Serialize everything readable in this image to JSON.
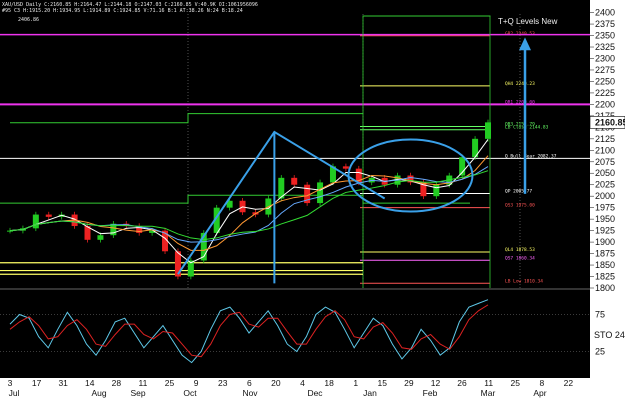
{
  "header": {
    "line1": "XAU/USD Daily  C:2160.85  H:2164.47  L:2144.18  O:2147.03  C:2160.85  V:40.9K  OI:1061956096",
    "line2": "#95 C3  H:1915.20  H:1934.95  L:1914.89  C:1924.85  V:71.16  B:1  AT:38.26  N:24  B:18.24",
    "top_value": "2406.86",
    "study_label": "T+Q Levels New"
  },
  "colors": {
    "background": "#000000",
    "axis_panel": "#ffffff",
    "bull_candle": "#22cc22",
    "bear_candle": "#ee2222",
    "magenta_level": "#ee33ee",
    "yellow_level": "#ffff66",
    "blue_annotation": "#3aa0e8",
    "stoch_k": "#5ec8e8",
    "stoch_d": "#dd2222"
  },
  "last_price_tag": "2160.85",
  "levels": [
    {
      "price": 2349.53,
      "label": "GR2 2349.53",
      "color": "#ff5555"
    },
    {
      "price": 2240.23,
      "label": "QH4 2240.23",
      "color": "#ffff66"
    },
    {
      "price": 2200.0,
      "label": "QR1 2200.00",
      "color": "#ee33ee"
    },
    {
      "price": 2151.79,
      "label": "QR3 2151.79",
      "color": "#66ff66"
    },
    {
      "price": 2144.83,
      "label": "LB Close 2144.83",
      "color": "#66ff66"
    },
    {
      "price": 2082.37,
      "label": "Q Bull Bear 2082.37",
      "color": "#ffffff"
    },
    {
      "price": 2005.77,
      "label": "QP 2005.77",
      "color": "#ffffff"
    },
    {
      "price": 1975.0,
      "label": "QS3 1975.00",
      "color": "#ff5555"
    },
    {
      "price": 1878.53,
      "label": "QL4 1878.53",
      "color": "#ffff66"
    },
    {
      "price": 1860.34,
      "label": "QS7 1860.34",
      "color": "#ff66ff"
    },
    {
      "price": 1810.34,
      "label": "LB Low 1810.34",
      "color": "#ff5555"
    }
  ],
  "chart_data": [
    {
      "type": "candlestick",
      "title": "XAU/USD Daily",
      "x_tick_labels": [
        "3",
        "17",
        "31",
        "14",
        "28",
        "11",
        "25",
        "9",
        "23",
        "6",
        "20",
        "4",
        "18",
        "1",
        "15",
        "29",
        "12",
        "26",
        "11",
        "25",
        "8",
        "22"
      ],
      "month_labels": [
        "Jul",
        "Aug",
        "Sep",
        "Oct",
        "Nov",
        "Dec",
        "Jan",
        "Feb",
        "Mar",
        "Apr"
      ],
      "ylim": [
        1800,
        2410
      ],
      "y_ticks": [
        1800,
        1825,
        1850,
        1875,
        1900,
        1925,
        1950,
        1975,
        2000,
        2025,
        2050,
        2075,
        2100,
        2125,
        2150,
        2175,
        2200,
        2225,
        2250,
        2275,
        2300,
        2325,
        2350,
        2375,
        2400
      ],
      "last_close": 2160.85,
      "approx_close_path": [
        {
          "date": "Jul 3",
          "close": 1925
        },
        {
          "date": "Jul 10",
          "close": 1930
        },
        {
          "date": "Jul 17",
          "close": 1960
        },
        {
          "date": "Jul 24",
          "close": 1955
        },
        {
          "date": "Jul 31",
          "close": 1960
        },
        {
          "date": "Aug 7",
          "close": 1935
        },
        {
          "date": "Aug 14",
          "close": 1905
        },
        {
          "date": "Aug 21",
          "close": 1915
        },
        {
          "date": "Aug 28",
          "close": 1940
        },
        {
          "date": "Sep 4",
          "close": 1935
        },
        {
          "date": "Sep 11",
          "close": 1920
        },
        {
          "date": "Sep 18",
          "close": 1925
        },
        {
          "date": "Sep 25",
          "close": 1880
        },
        {
          "date": "Oct 2",
          "close": 1825
        },
        {
          "date": "Oct 9",
          "close": 1860
        },
        {
          "date": "Oct 16",
          "close": 1920
        },
        {
          "date": "Oct 23",
          "close": 1975
        },
        {
          "date": "Oct 30",
          "close": 1990
        },
        {
          "date": "Nov 6",
          "close": 1965
        },
        {
          "date": "Nov 13",
          "close": 1960
        },
        {
          "date": "Nov 20",
          "close": 1995
        },
        {
          "date": "Nov 27",
          "close": 2040
        },
        {
          "date": "Dec 4",
          "close": 2025
        },
        {
          "date": "Dec 11",
          "close": 1985
        },
        {
          "date": "Dec 18",
          "close": 2030
        },
        {
          "date": "Dec 25",
          "close": 2065
        },
        {
          "date": "Jan 1",
          "close": 2060
        },
        {
          "date": "Jan 8",
          "close": 2030
        },
        {
          "date": "Jan 15",
          "close": 2040
        },
        {
          "date": "Jan 22",
          "close": 2025
        },
        {
          "date": "Jan 29",
          "close": 2045
        },
        {
          "date": "Feb 5",
          "close": 2030
        },
        {
          "date": "Feb 12",
          "close": 2000
        },
        {
          "date": "Feb 19",
          "close": 2025
        },
        {
          "date": "Feb 26",
          "close": 2045
        },
        {
          "date": "Mar 1",
          "close": 2085
        },
        {
          "date": "Mar 4",
          "close": 2125
        },
        {
          "date": "Mar 6",
          "close": 2160.85
        }
      ]
    },
    {
      "type": "line",
      "title": "STO 24",
      "y_ticks": [
        25,
        75
      ],
      "series": [
        {
          "name": "%K",
          "values": [
            62,
            75,
            70,
            45,
            30,
            55,
            78,
            60,
            35,
            20,
            40,
            65,
            70,
            50,
            30,
            45,
            60,
            40,
            20,
            10,
            25,
            55,
            80,
            85,
            70,
            50,
            65,
            80,
            60,
            35,
            25,
            45,
            75,
            85,
            78,
            55,
            30,
            50,
            70,
            60,
            35,
            15,
            30,
            55,
            40,
            20,
            30,
            65,
            85,
            90,
            95
          ]
        },
        {
          "name": "%D",
          "values": [
            55,
            65,
            72,
            60,
            42,
            45,
            60,
            68,
            55,
            35,
            32,
            48,
            62,
            62,
            48,
            42,
            52,
            50,
            35,
            20,
            18,
            35,
            60,
            75,
            78,
            62,
            58,
            70,
            70,
            52,
            35,
            35,
            55,
            72,
            80,
            68,
            45,
            42,
            58,
            64,
            50,
            30,
            28,
            42,
            48,
            35,
            28,
            45,
            68,
            80,
            88
          ]
        }
      ]
    }
  ]
}
